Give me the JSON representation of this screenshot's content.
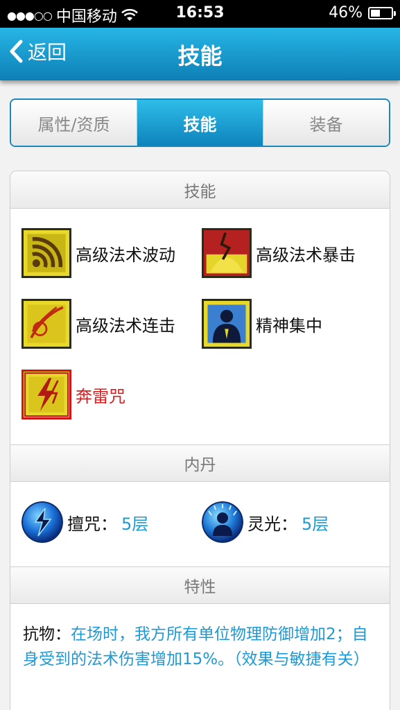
{
  "status_bar": {
    "signal_dots": "●●●○○",
    "carrier": "中国移动",
    "time": "16:53",
    "battery_pct": "46%",
    "battery_level": 0.46
  },
  "nav": {
    "back_label": "返回",
    "title": "技能"
  },
  "tabs": [
    {
      "label": "属性/资质",
      "active": false
    },
    {
      "label": "技能",
      "active": true
    },
    {
      "label": "装备",
      "active": false
    }
  ],
  "sections": {
    "skills_header": "技能",
    "neidan_header": "内丹",
    "traits_header": "特性"
  },
  "skills": [
    {
      "name": "高级法术波动",
      "icon": "wave-icon"
    },
    {
      "name": "高级法术暴击",
      "icon": "crack-icon"
    },
    {
      "name": "高级法术连击",
      "icon": "slash-icon"
    },
    {
      "name": "精神集中",
      "icon": "meditate-icon"
    },
    {
      "name": "奔雷咒",
      "icon": "lightning-icon",
      "selected": true
    }
  ],
  "neidan": [
    {
      "name": "擅咒：",
      "value": "5层",
      "icon": "lightning-orb-icon"
    },
    {
      "name": "灵光：",
      "value": "5层",
      "icon": "aura-orb-icon"
    }
  ],
  "trait": {
    "name": "抗物：",
    "text": "在场时，我方所有单位物理防御增加2；自身受到的法术伤害增加15%。（效果与敏捷有关）"
  },
  "colors": {
    "nav_blue": "#0d7fb6",
    "accent_blue": "#1d9ad6",
    "selected_red": "#e01b1b",
    "icon_yellow": "#e5d52a"
  }
}
